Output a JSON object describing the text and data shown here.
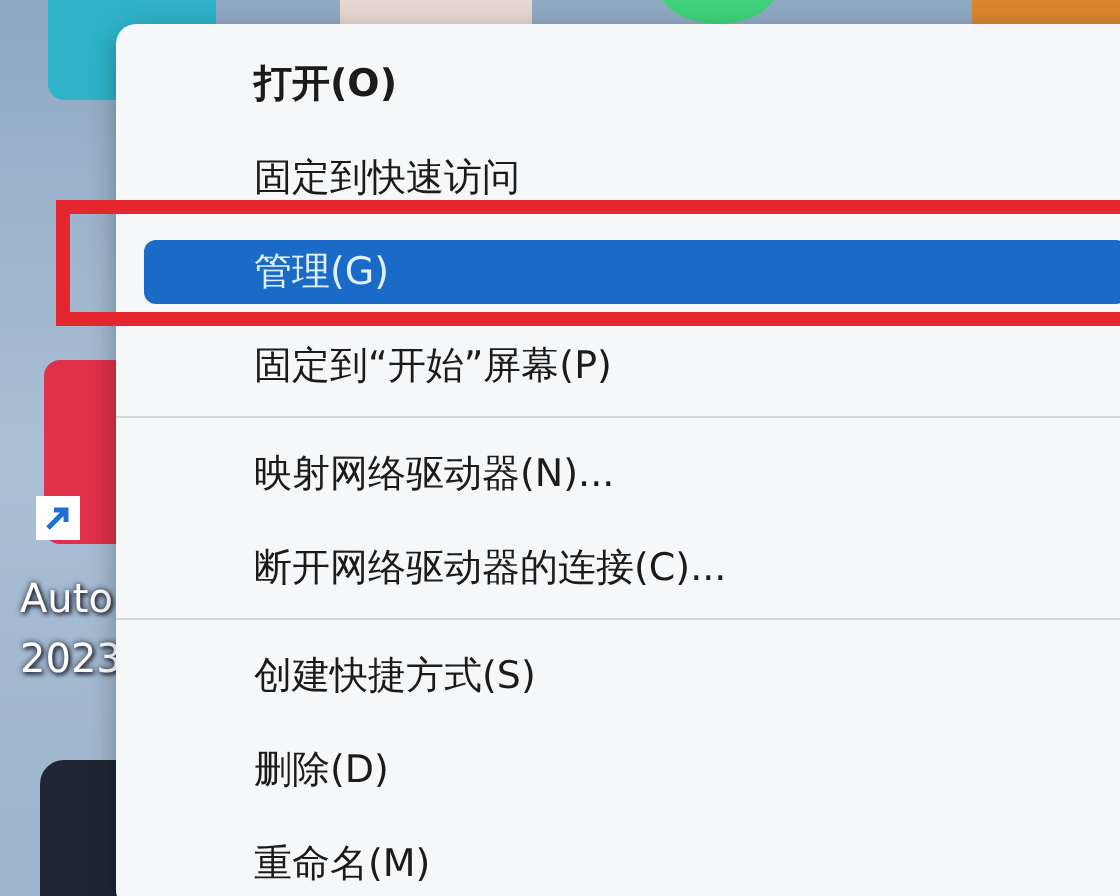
{
  "desktop": {
    "icons": [
      {
        "color": "#2fb3c9"
      },
      {
        "color": "#e8d6d0"
      },
      {
        "color": "#3fd27a"
      },
      {
        "color": "#d9862f"
      },
      {
        "color": "#e0304a"
      },
      {
        "color": "#1e2533"
      }
    ],
    "labels": [
      "Auto",
      "2023"
    ]
  },
  "menu": {
    "items": [
      {
        "kind": "item",
        "label": "打开(O)",
        "default": true,
        "selected": false,
        "highlighted": false
      },
      {
        "kind": "item",
        "label": "固定到快速访问",
        "default": false,
        "selected": false,
        "highlighted": false
      },
      {
        "kind": "item",
        "label": "管理(G)",
        "default": false,
        "selected": true,
        "highlighted": true
      },
      {
        "kind": "item",
        "label": "固定到“开始”屏幕(P)",
        "default": false,
        "selected": false,
        "highlighted": false
      },
      {
        "kind": "separator"
      },
      {
        "kind": "item",
        "label": "映射网络驱动器(N)...",
        "default": false,
        "selected": false,
        "highlighted": false
      },
      {
        "kind": "item",
        "label": "断开网络驱动器的连接(C)...",
        "default": false,
        "selected": false,
        "highlighted": false
      },
      {
        "kind": "separator"
      },
      {
        "kind": "item",
        "label": "创建快捷方式(S)",
        "default": false,
        "selected": false,
        "highlighted": false
      },
      {
        "kind": "item",
        "label": "删除(D)",
        "default": false,
        "selected": false,
        "highlighted": false
      },
      {
        "kind": "item",
        "label": "重命名(M)",
        "default": false,
        "selected": false,
        "highlighted": false
      }
    ]
  }
}
